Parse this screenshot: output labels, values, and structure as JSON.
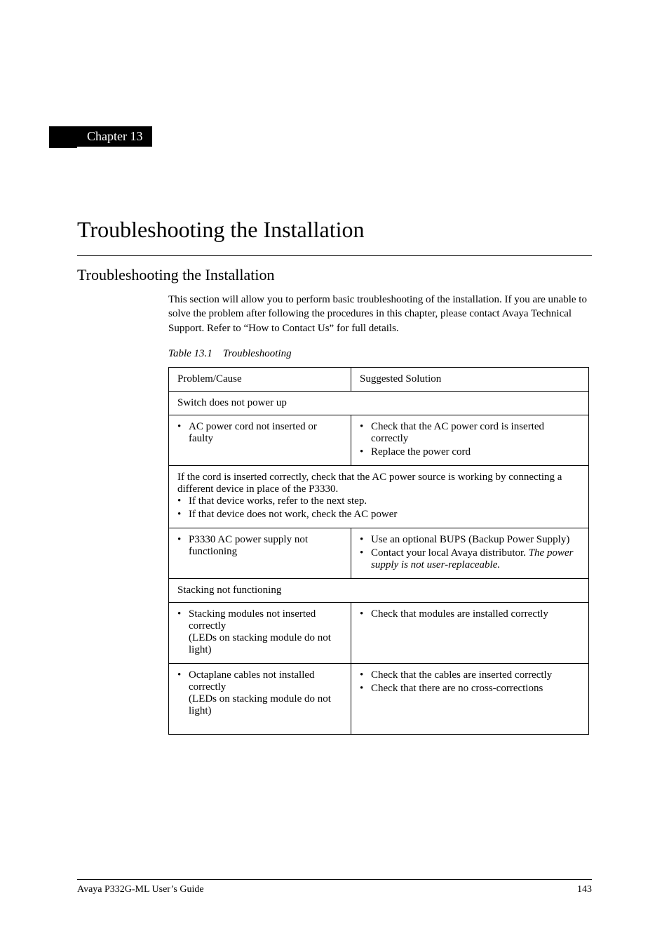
{
  "chapter": {
    "label": "Chapter 13",
    "title": "Troubleshooting the Installation"
  },
  "section": {
    "title": "Troubleshooting the Installation",
    "intro": "This section will allow you to perform basic troubleshooting of the installation. If you are unable to solve the problem after following the procedures in this chapter, please contact Avaya Technical Support. Refer to “How to Contact Us” for full details."
  },
  "table": {
    "caption_number": "Table 13.1",
    "caption_title": "Troubleshooting",
    "header_problem": "Problem/Cause",
    "header_solution": "Suggested Solution",
    "row_switch_header": "Switch does not power up",
    "row_ac_cord": {
      "problem": "AC power cord not inserted or faulty",
      "solution1": "Check that the AC power cord is inserted correctly",
      "solution2": "Replace the power cord"
    },
    "row_cord_check": {
      "line1": "If the cord is inserted correctly, check that the AC power source is working by connecting a different device in place of the P3330.",
      "bullet1": "If that device works, refer to the next step.",
      "bullet2": "If that device does not work, check the AC power"
    },
    "row_psu": {
      "problem": "P3330 AC power supply not functioning",
      "solution1": "Use an optional BUPS (Backup Power Supply)",
      "solution2_pre": "Contact your local Avaya distributor. ",
      "solution2_italic": "The power supply is not user-replaceable."
    },
    "row_stacking_header": "Stacking not functioning",
    "row_stacking_modules": {
      "problem_line1": "Stacking modules not inserted correctly",
      "problem_line2": "(LEDs on stacking module do not light)",
      "solution1": "Check that modules are installed correctly"
    },
    "row_octaplane": {
      "problem_line1": "Octaplane cables not installed correctly",
      "problem_line2": "(LEDs on stacking module do not light)",
      "solution1": "Check that the cables are inserted correctly",
      "solution2": "Check that there are no cross-corrections"
    }
  },
  "footer": {
    "left": "Avaya P332G-ML User’s Guide",
    "right": "143"
  }
}
